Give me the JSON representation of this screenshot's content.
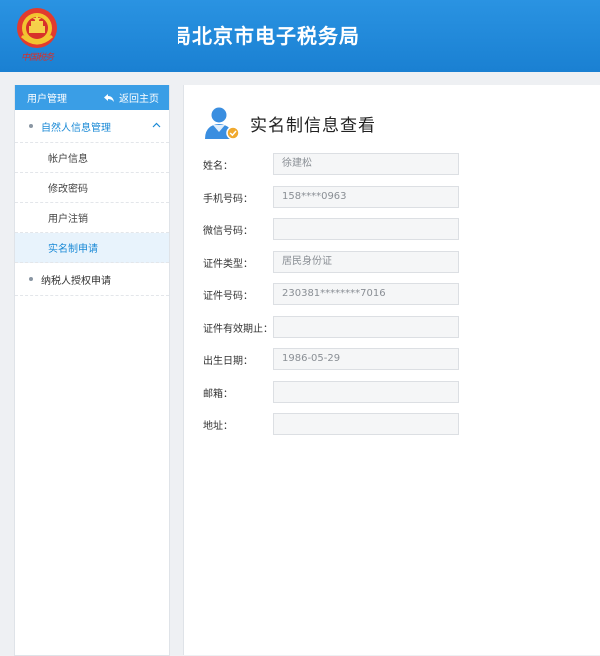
{
  "header": {
    "title_partial": "局",
    "title": "北京市电子税务局",
    "emblem_script": "中国税务"
  },
  "sidebar": {
    "head_title": "用户管理",
    "back_label": "返回主页",
    "groups": [
      {
        "label": "自然人信息管理",
        "items": [
          "帐户信息",
          "修改密码",
          "用户注销",
          "实名制申请"
        ]
      },
      {
        "label": "纳税人授权申请"
      }
    ]
  },
  "main": {
    "page_title": "实名制信息查看",
    "fields": [
      {
        "label": "姓名：",
        "value": "徐建松"
      },
      {
        "label": "手机号码：",
        "value": "158****0963"
      },
      {
        "label": "微信号码：",
        "value": ""
      },
      {
        "label": "证件类型：",
        "value": "居民身份证"
      },
      {
        "label": "证件号码：",
        "value": "230381********7016"
      },
      {
        "label": "证件有效期止：",
        "value": ""
      },
      {
        "label": "出生日期：",
        "value": "1986-05-29"
      },
      {
        "label": "邮箱：",
        "value": ""
      },
      {
        "label": "地址：",
        "value": ""
      }
    ]
  },
  "colors": {
    "header_blue": "#1d87d9",
    "sidebar_head_blue": "#3a9ee6",
    "active_text": "#1b8ad6",
    "active_bg": "#e8f3fc"
  }
}
